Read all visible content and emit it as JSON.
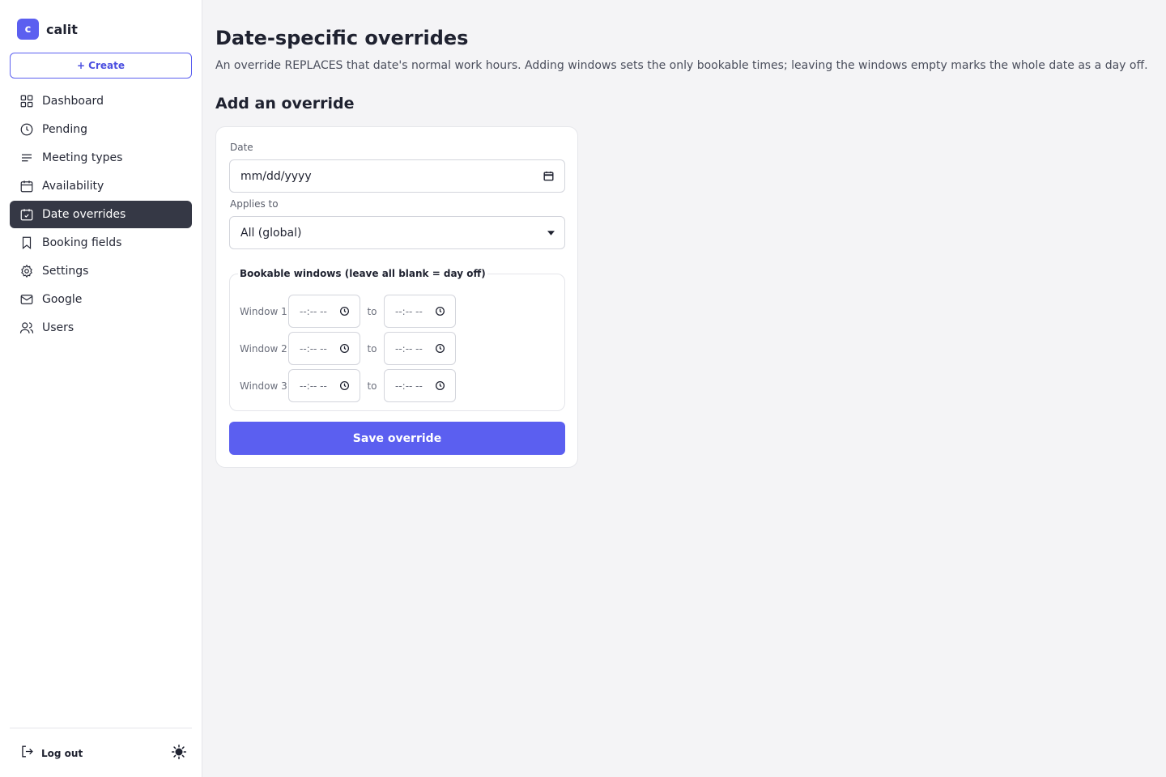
{
  "brand": {
    "logo_letter": "c",
    "name": "calit"
  },
  "sidebar": {
    "create_label": "+ Create",
    "items": [
      {
        "label": "Dashboard",
        "icon": "grid-icon"
      },
      {
        "label": "Pending",
        "icon": "clock-icon"
      },
      {
        "label": "Meeting types",
        "icon": "list-icon"
      },
      {
        "label": "Availability",
        "icon": "calendar-icon"
      },
      {
        "label": "Date overrides",
        "icon": "calendar-check-icon",
        "active": true
      },
      {
        "label": "Booking fields",
        "icon": "bookmark-icon"
      },
      {
        "label": "Settings",
        "icon": "gear-icon"
      },
      {
        "label": "Google",
        "icon": "mail-icon"
      },
      {
        "label": "Users",
        "icon": "users-icon"
      }
    ],
    "logout_label": "Log out",
    "theme_icon": "sun-icon"
  },
  "main": {
    "title": "Date-specific overrides",
    "description": "An override REPLACES that date's normal work hours. Adding windows sets the only bookable times; leaving the windows empty marks the whole date as a day off.",
    "section_title": "Add an override",
    "form": {
      "date_label": "Date",
      "date_placeholder": "mm/dd/yyyy",
      "applies_label": "Applies to",
      "applies_value": "All (global)",
      "windows_legend": "Bookable windows (leave all blank = day off)",
      "to_label": "to",
      "time_placeholder": "--:-- --",
      "windows": [
        {
          "label": "Window 1"
        },
        {
          "label": "Window 2"
        },
        {
          "label": "Window 3"
        }
      ],
      "save_label": "Save override"
    }
  },
  "colors": {
    "accent": "#5b5ff0",
    "active_nav": "#353845"
  }
}
